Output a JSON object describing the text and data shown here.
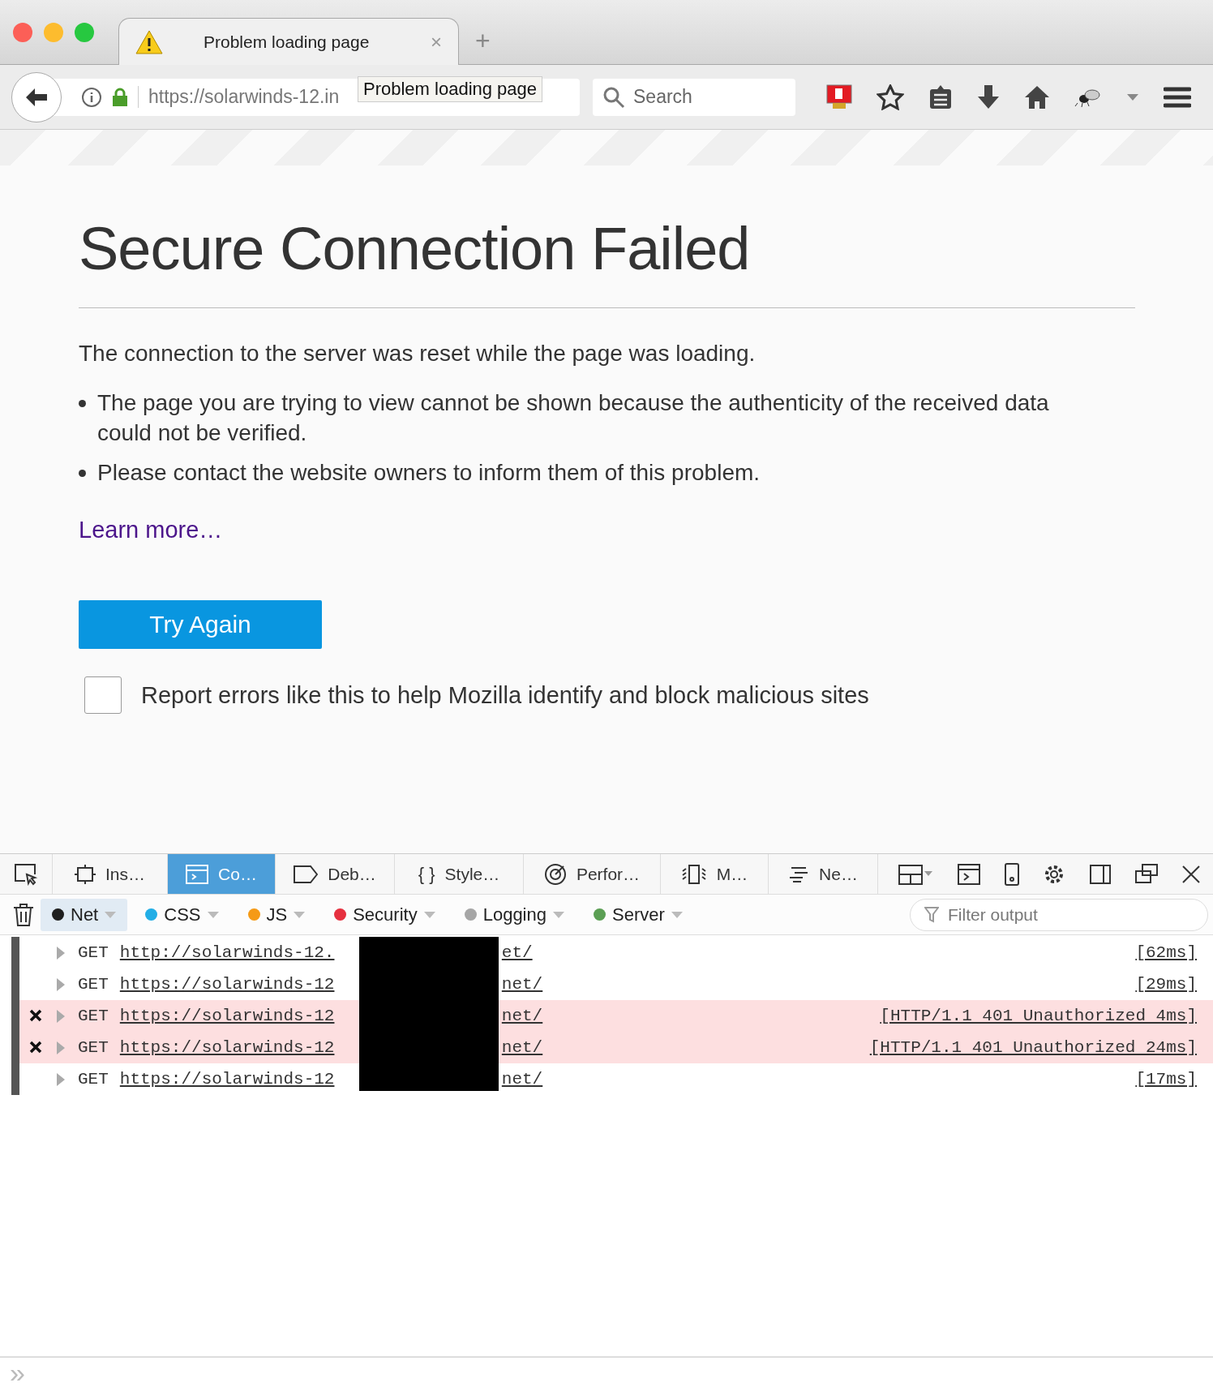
{
  "browser": {
    "tab": {
      "title": "Problem loading page",
      "close": "×"
    },
    "new_tab": "+",
    "url": "https://solarwinds-12.in",
    "tooltip": "Problem loading page",
    "search": {
      "placeholder": "Search"
    }
  },
  "page": {
    "title": "Secure Connection Failed",
    "intro": "The connection to the server was reset while the page was loading.",
    "bullets": [
      "The page you are trying to view cannot be shown because the authenticity of the received data could not be verified.",
      "Please contact the website owners to inform them of this problem."
    ],
    "learn_more": "Learn more…",
    "button": "Try Again",
    "report": {
      "label": "Report errors like this to help Mozilla identify and block malicious sites",
      "checked": false
    }
  },
  "devtools": {
    "tabs": [
      {
        "label": "Ins…",
        "selected": false
      },
      {
        "label": "Co…",
        "selected": true
      },
      {
        "label": "Deb…",
        "selected": false
      },
      {
        "label": "Style…",
        "glyph": "{ }",
        "selected": false
      },
      {
        "label": "Perfor…",
        "selected": false
      },
      {
        "label": "M…",
        "selected": false
      },
      {
        "label": "Ne…",
        "selected": false
      }
    ],
    "filters": [
      {
        "label": "Net",
        "color": "#1f1f1f",
        "selected": true
      },
      {
        "label": "CSS",
        "color": "#22aee6",
        "selected": false
      },
      {
        "label": "JS",
        "color": "#f59a16",
        "selected": false
      },
      {
        "label": "Security",
        "color": "#e6303f",
        "selected": false
      },
      {
        "label": "Logging",
        "color": "#a6a6a6",
        "selected": false
      },
      {
        "label": "Server",
        "color": "#5b9f54",
        "selected": false
      }
    ],
    "filter_placeholder": "Filter output",
    "log": [
      {
        "error": false,
        "method": "GET",
        "url_start": "http://solarwinds-12.",
        "url_end": "et/",
        "status": "[62ms]"
      },
      {
        "error": false,
        "method": "GET",
        "url_start": "https://solarwinds-12",
        "url_end": "net/",
        "status": "[29ms]"
      },
      {
        "error": true,
        "method": "GET",
        "url_start": "https://solarwinds-12",
        "url_end": "net/",
        "status": "[HTTP/1.1 401 Unauthorized 4ms]"
      },
      {
        "error": true,
        "method": "GET",
        "url_start": "https://solarwinds-12",
        "url_end": "net/",
        "status": "[HTTP/1.1 401 Unauthorized 24ms]"
      },
      {
        "error": false,
        "method": "GET",
        "url_start": "https://solarwinds-12",
        "url_end": "net/",
        "status": "[17ms]"
      }
    ],
    "prompt": "»"
  }
}
